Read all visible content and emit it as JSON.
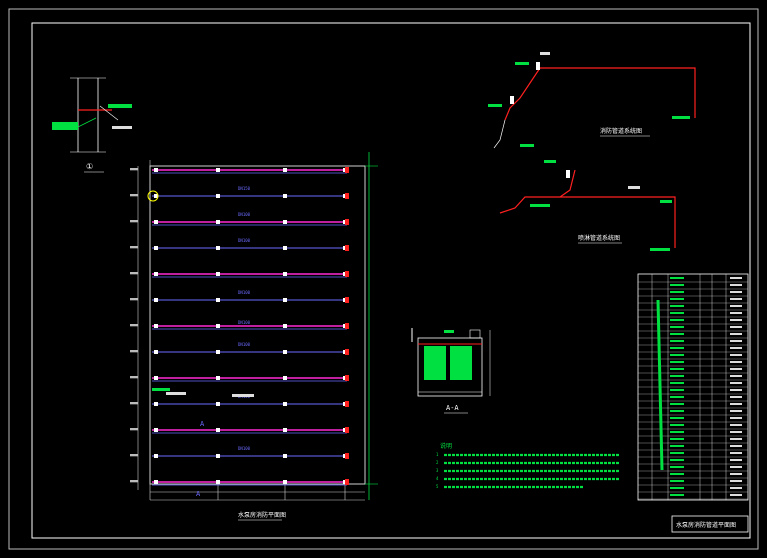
{
  "title_block": {
    "text": "水泵房消防管道平面图"
  },
  "detail_label": {
    "text": "①"
  },
  "plan_caption": {
    "text": "水泵房消防平面图"
  },
  "iso1_caption": {
    "text": "消防管道系统图"
  },
  "iso2_caption": {
    "text": "喷淋管道系统图"
  },
  "section_caption": {
    "text": "A-A"
  },
  "notes": {
    "heading": "说明",
    "lines": [
      "1",
      "2",
      "3",
      "4",
      "5"
    ]
  },
  "plan": {
    "axis_top": "A",
    "axis_bottom": "A",
    "branch_labels": [
      "DN150",
      "DN100",
      "DN100",
      "DN100",
      "DN100",
      "DN100",
      "DN100",
      "DN100"
    ]
  },
  "colors": {
    "background": "#000000",
    "frame": "#ffffff",
    "pipe_magenta": "#ff2ad4",
    "pipe_blue": "#6a6aff",
    "pipe_red": "#ff2020",
    "green": "#00e040",
    "grid": "#d0d0d0"
  }
}
